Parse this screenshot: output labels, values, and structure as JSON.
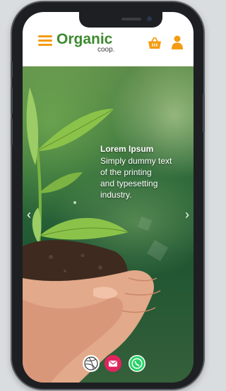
{
  "header": {
    "logo_text": "Organic",
    "logo_sub": "coop."
  },
  "hero": {
    "title": "Lorem Ipsum",
    "text": "Simply dummy text\n of the printing\nand typesetting\nindustry.",
    "prev_arrow": "‹",
    "next_arrow": "›"
  },
  "colors": {
    "accent": "#f39c12",
    "brand_green": "#3c8a2e",
    "mail_red": "#e0245e",
    "whatsapp_green": "#25d366"
  },
  "icons": [
    "menu-icon",
    "basket-icon",
    "user-icon",
    "dribbble-icon",
    "mail-icon",
    "whatsapp-icon"
  ]
}
